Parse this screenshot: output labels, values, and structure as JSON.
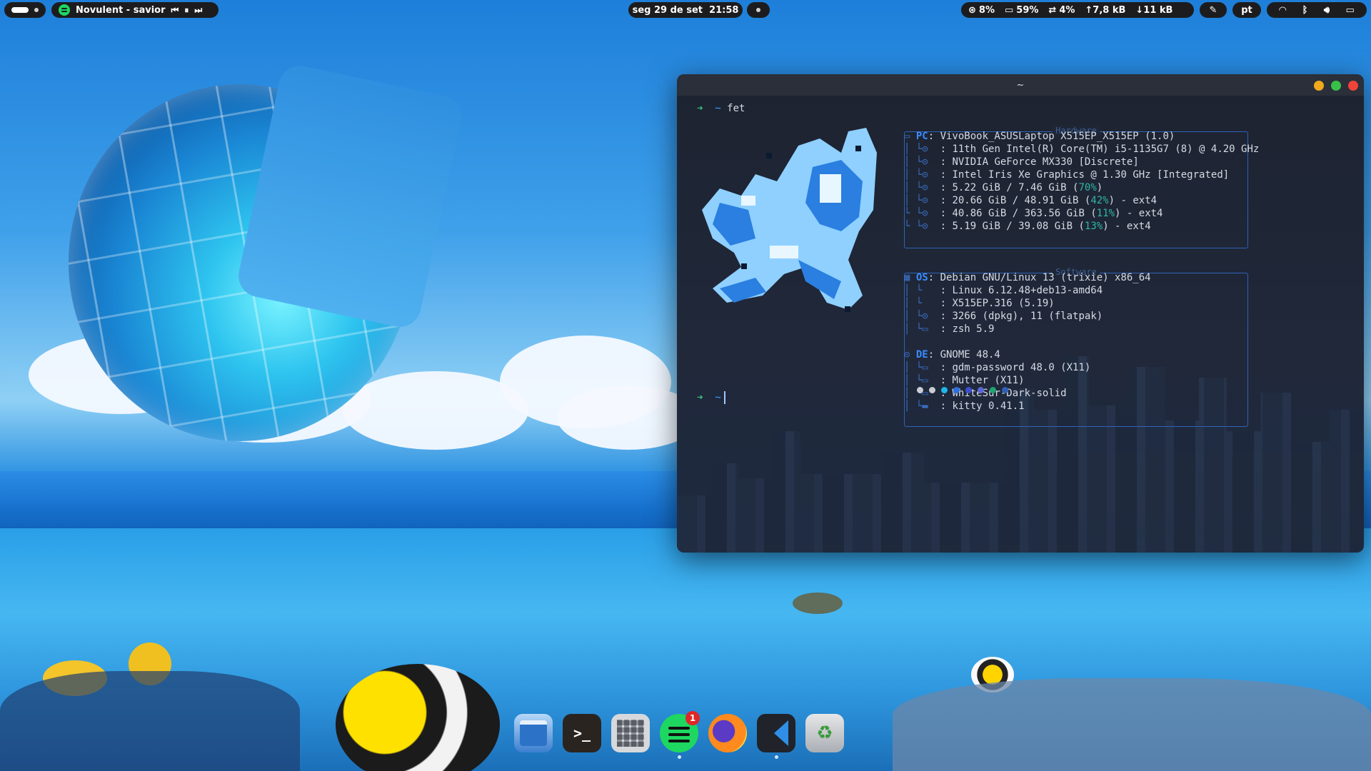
{
  "topbar": {
    "media": {
      "track": "Novulent - savior"
    },
    "clock": "seg 29 de set  21:58",
    "indicators": {
      "cpu": "8%",
      "memory": "59%",
      "swap": "4%",
      "upload": "↑7,8 kB",
      "download": "↓11 kB",
      "keyboard_layout": "pt"
    }
  },
  "terminal": {
    "title": "~",
    "command": "fet",
    "prompt_arrow": "➜",
    "prompt_dir": "~",
    "hardware_label": "Hardware",
    "software_label": "Software",
    "hardware": [
      {
        "key": "PC",
        "value": "VivoBook_ASUSLaptop X515EP_X515EP (1.0)"
      },
      {
        "key": "",
        "value": "11th Gen Intel(R) Core(TM) i5-1135G7 (8) @ 4.20 GHz"
      },
      {
        "key": "",
        "value": "NVIDIA GeForce MX330 [Discrete]"
      },
      {
        "key": "",
        "value": "Intel Iris Xe Graphics @ 1.30 GHz [Integrated]"
      },
      {
        "key": "",
        "value": "5.22 GiB / 7.46 GiB (",
        "pct": "70%",
        "tail": ")"
      },
      {
        "key": "",
        "value": "20.66 GiB / 48.91 GiB (",
        "pct": "42%",
        "tail": ") - ext4"
      },
      {
        "key": "",
        "value": "40.86 GiB / 363.56 GiB (",
        "pct": "11%",
        "tail": ") - ext4"
      },
      {
        "key": "",
        "value": "5.19 GiB / 39.08 GiB (",
        "pct": "13%",
        "tail": ") - ext4"
      }
    ],
    "os": [
      {
        "key": "OS",
        "value": "Debian GNU/Linux 13 (trixie) x86_64"
      },
      {
        "key": "",
        "value": "Linux 6.12.48+deb13-amd64"
      },
      {
        "key": "",
        "value": "X515EP.316 (5.19)"
      },
      {
        "key": "",
        "value": "3266 (dpkg), 11 (flatpak)"
      },
      {
        "key": "",
        "value": "zsh 5.9"
      }
    ],
    "de": [
      {
        "key": "DE",
        "value": "GNOME 48.4"
      },
      {
        "key": "",
        "value": "gdm-password 48.0 (X11)"
      },
      {
        "key": "",
        "value": "Mutter (X11)"
      },
      {
        "key": "",
        "value": "WhiteSur-Dark-solid"
      },
      {
        "key": "",
        "value": "kitty 0.41.1"
      }
    ],
    "palette": [
      "#c9ccd3",
      "#c9ccd3",
      "#1fb7e8",
      "#2b6fe0",
      "#3d4fd1",
      "#5a66d6",
      "#1fa36f",
      "#2f5fb5"
    ]
  },
  "dock": {
    "apps": [
      {
        "name": "files-icon"
      },
      {
        "name": "terminal-icon"
      },
      {
        "name": "calculator-icon"
      },
      {
        "name": "spotify-icon",
        "badge": "1"
      },
      {
        "name": "firefox-icon"
      },
      {
        "name": "vscode-icon"
      },
      {
        "name": "trash-icon"
      }
    ]
  },
  "colors": {
    "accent": "#3a8cff",
    "bar_bg": "#1c1c1e",
    "spotify": "#1ed760"
  }
}
